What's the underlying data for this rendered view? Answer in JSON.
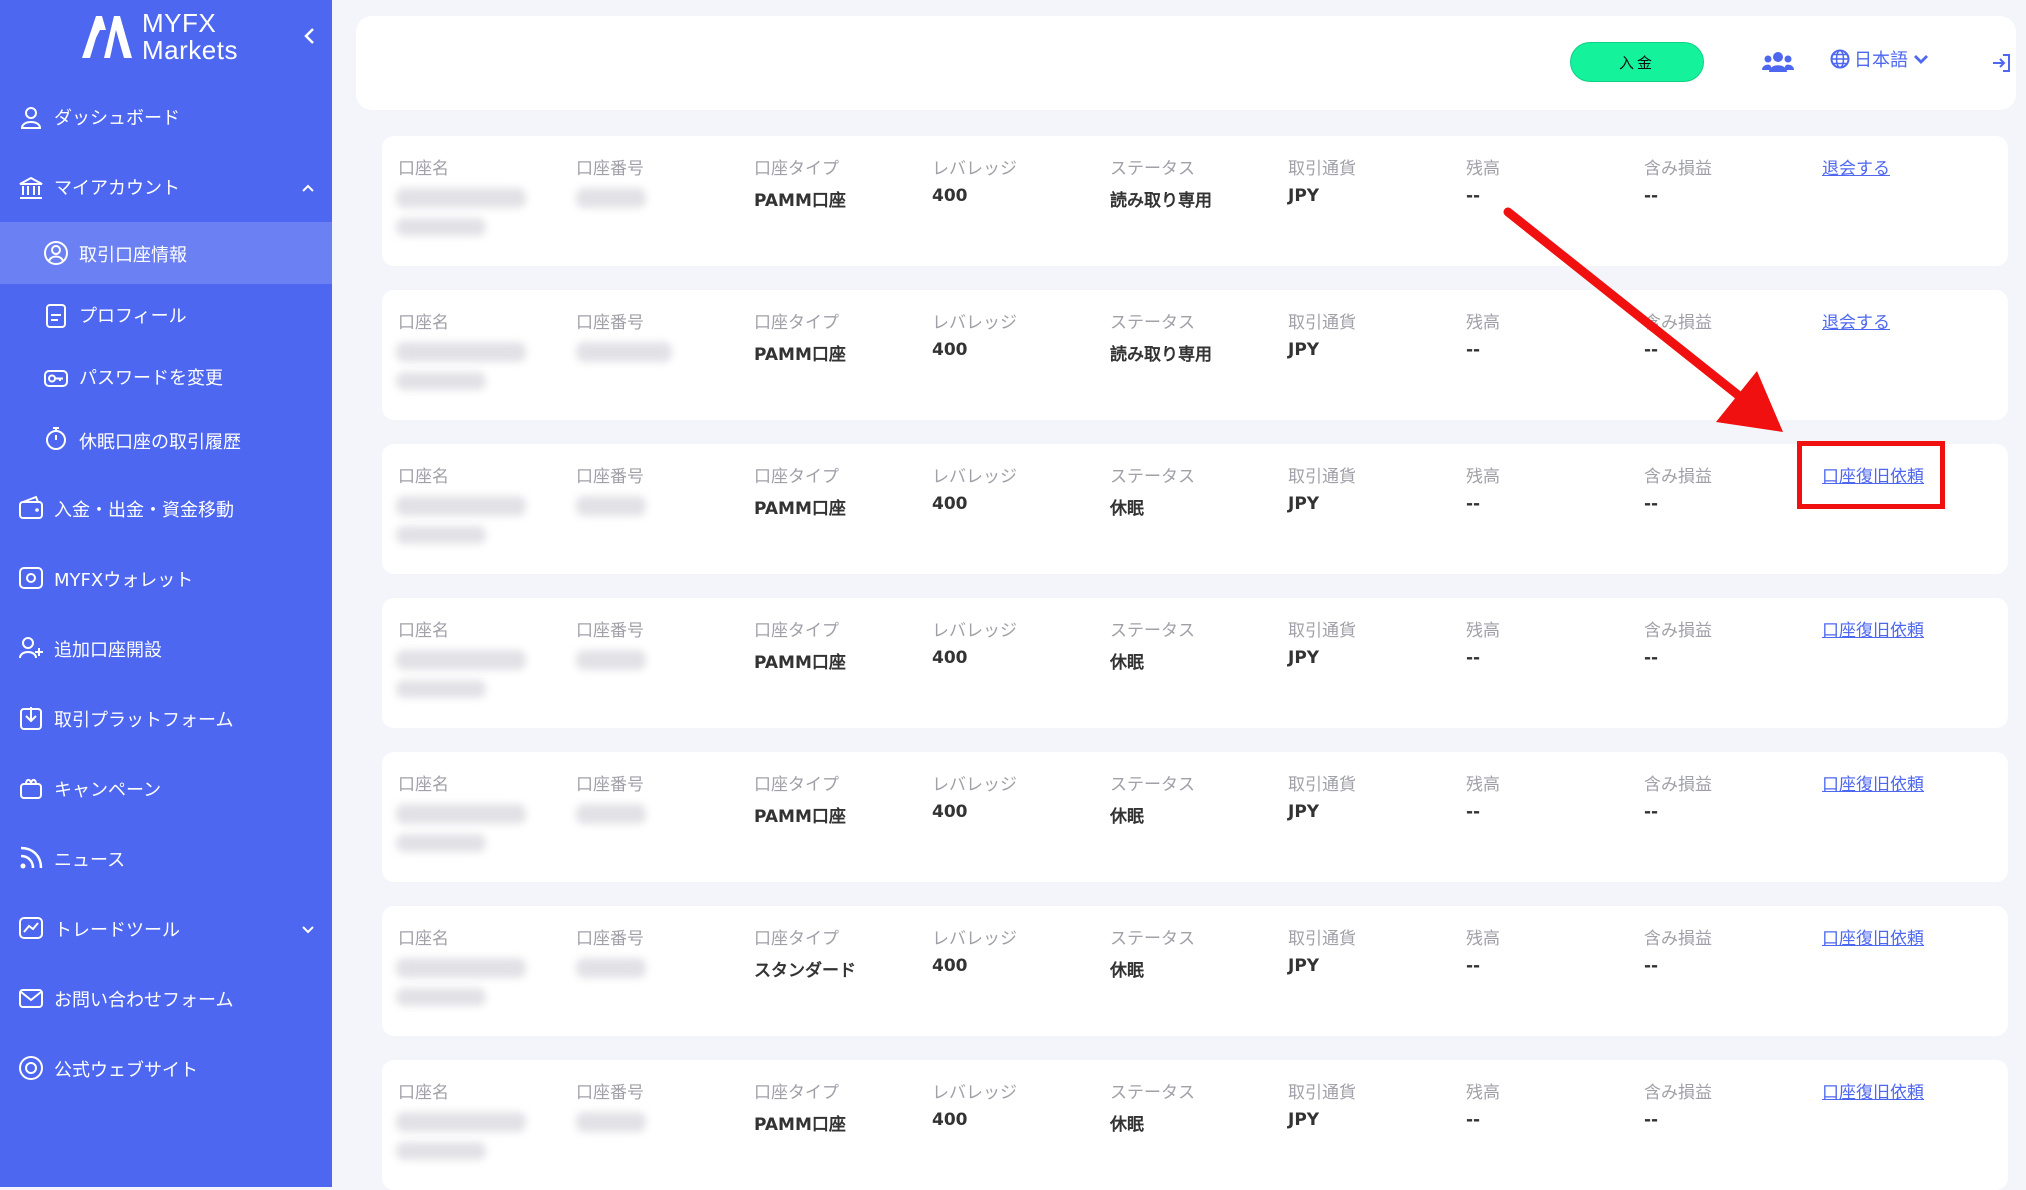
{
  "brand": {
    "line1": "MYFX",
    "line2": "Markets"
  },
  "sidebar": {
    "items": [
      {
        "label": "ダッシュボード"
      },
      {
        "label": "マイアカウント"
      },
      {
        "label": "取引口座情報"
      },
      {
        "label": "プロフィール"
      },
      {
        "label": "パスワードを変更"
      },
      {
        "label": "休眠口座の取引履歴"
      },
      {
        "label": "入金・出金・資金移動"
      },
      {
        "label": "MYFXウォレット"
      },
      {
        "label": "追加口座開設"
      },
      {
        "label": "取引プラットフォーム"
      },
      {
        "label": "キャンペーン"
      },
      {
        "label": "ニュース"
      },
      {
        "label": "トレードツール"
      },
      {
        "label": "お問い合わせフォーム"
      },
      {
        "label": "公式ウェブサイト"
      }
    ]
  },
  "header": {
    "deposit_label": "入金",
    "language": "日本語"
  },
  "columns": {
    "name": "口座名",
    "number": "口座番号",
    "type": "口座タイプ",
    "leverage": "レバレッジ",
    "status": "ステータス",
    "currency": "取引通貨",
    "balance": "残高",
    "pnl": "含み損益"
  },
  "accounts": [
    {
      "type": "PAMM口座",
      "leverage": "400",
      "status": "読み取り専用",
      "currency": "JPY",
      "balance": "--",
      "pnl": "--",
      "action": "退会する"
    },
    {
      "type": "PAMM口座",
      "leverage": "400",
      "status": "読み取り専用",
      "currency": "JPY",
      "balance": "--",
      "pnl": "--",
      "action": "退会する"
    },
    {
      "type": "PAMM口座",
      "leverage": "400",
      "status": "休眠",
      "currency": "JPY",
      "balance": "--",
      "pnl": "--",
      "action": "口座復旧依頼"
    },
    {
      "type": "PAMM口座",
      "leverage": "400",
      "status": "休眠",
      "currency": "JPY",
      "balance": "--",
      "pnl": "--",
      "action": "口座復旧依頼"
    },
    {
      "type": "PAMM口座",
      "leverage": "400",
      "status": "休眠",
      "currency": "JPY",
      "balance": "--",
      "pnl": "--",
      "action": "口座復旧依頼"
    },
    {
      "type": "スタンダード",
      "leverage": "400",
      "status": "休眠",
      "currency": "JPY",
      "balance": "--",
      "pnl": "--",
      "action": "口座復旧依頼"
    },
    {
      "type": "PAMM口座",
      "leverage": "400",
      "status": "休眠",
      "currency": "JPY",
      "balance": "--",
      "pnl": "--",
      "action": "口座復旧依頼"
    }
  ],
  "colors": {
    "sidebar": "#4d67f0",
    "active": "#6b80f3",
    "deposit": "#14f29c",
    "highlight": "#f01010"
  }
}
